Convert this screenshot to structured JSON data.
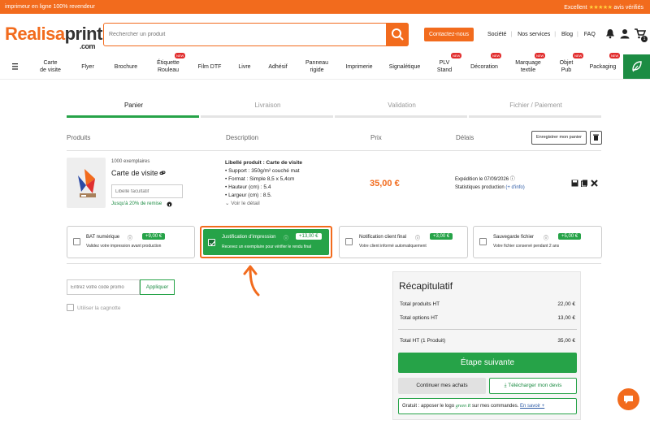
{
  "topbar": {
    "left": "imprimeur en ligne 100% revendeur",
    "excellent": "Excellent",
    "stars": "★★★★★",
    "verified": "avis vérifiés"
  },
  "logo": {
    "part1": "Realisa",
    "part2": "print",
    "com": ".com"
  },
  "search": {
    "placeholder": "Rechercher un produit"
  },
  "header": {
    "contact": "Contactez-nous",
    "nav": [
      "Société",
      "Nos services",
      "Blog",
      "FAQ"
    ],
    "cart_count": "1"
  },
  "categories": [
    {
      "label": "Carte\nde visite",
      "new": false
    },
    {
      "label": "Flyer",
      "new": false
    },
    {
      "label": "Brochure",
      "new": false
    },
    {
      "label": "Étiquette\nRouleau",
      "new": true
    },
    {
      "label": "Film DTF",
      "new": false
    },
    {
      "label": "Livre",
      "new": false
    },
    {
      "label": "Adhésif",
      "new": false
    },
    {
      "label": "Panneau\nrigide",
      "new": false
    },
    {
      "label": "Imprimerie",
      "new": false
    },
    {
      "label": "Signalétique",
      "new": false
    },
    {
      "label": "PLV\nStand",
      "new": true
    },
    {
      "label": "Décoration",
      "new": true
    },
    {
      "label": "Marquage\ntextile",
      "new": true
    },
    {
      "label": "Objet\nPub",
      "new": true
    },
    {
      "label": "Packaging",
      "new": true
    }
  ],
  "new_badge": "NEW",
  "steps": [
    "Panier",
    "Livraison",
    "Validation",
    "Fichier / Paiement"
  ],
  "columns": {
    "products": "Produits",
    "description": "Description",
    "price": "Prix",
    "delays": "Délais"
  },
  "save_cart": "Enregistrer mon panier",
  "product": {
    "qty": "1000 exemplaires",
    "name": "Carte de visite",
    "label_placeholder": "Libellé facultatif",
    "discount": "Jusqu'à 20% de remise",
    "desc_title": "Libellé produit : Carte de visite",
    "desc_lines": [
      "• Support : 350g/m² couché mat",
      "• Format : Simple 8,5 x 5,4cm",
      "• Hauteur (cm) : 5.4",
      "• Largeur (cm) : 8.5."
    ],
    "see_detail": "Voir le détail",
    "price": "35,00 €",
    "shipping": "Expédition le 07/09/2026",
    "stats": "Statistiques production",
    "info": "(+ d'info)"
  },
  "options": [
    {
      "title": "BAT numérique",
      "price": "+9,00 €",
      "desc": "Validez votre impression avant production",
      "checked": false
    },
    {
      "title": "Justification d'impression",
      "price": "+13,00 €",
      "desc": "Recevez un exemplaire pour vérifier le rendu final",
      "checked": true
    },
    {
      "title": "Notification client final",
      "price": "+3,00 €",
      "desc": "Votre client informé automatiquement",
      "checked": false
    },
    {
      "title": "Sauvegarde fichier",
      "price": "+5,00 €",
      "desc": "Votre fichier conservé pendant 2 ans",
      "checked": false
    }
  ],
  "promo": {
    "placeholder": "Entrez votre code promo",
    "apply": "Appliquer",
    "kitty": "Utiliser la cagnotte"
  },
  "recap": {
    "title": "Récapitulatif",
    "rows": [
      {
        "label": "Total produits HT",
        "value": "22,00 €"
      },
      {
        "label": "Total options HT",
        "value": "13,00 €"
      },
      {
        "label": "Total HT (1 Produit)",
        "value": "35,00 €"
      }
    ],
    "next": "Étape suivante",
    "continue": "Continuer mes achats",
    "download": "Télécharger mon devis",
    "green_text1": "Gratuit : apposer le logo",
    "green_logo": "green",
    "green_r": "R",
    "green_text2": "sur mes commandes.",
    "learn_more": "En savoir +"
  },
  "colors": {
    "brand_orange": "#f26b1d",
    "green": "#26a348",
    "dark_green": "#1c8c43"
  }
}
